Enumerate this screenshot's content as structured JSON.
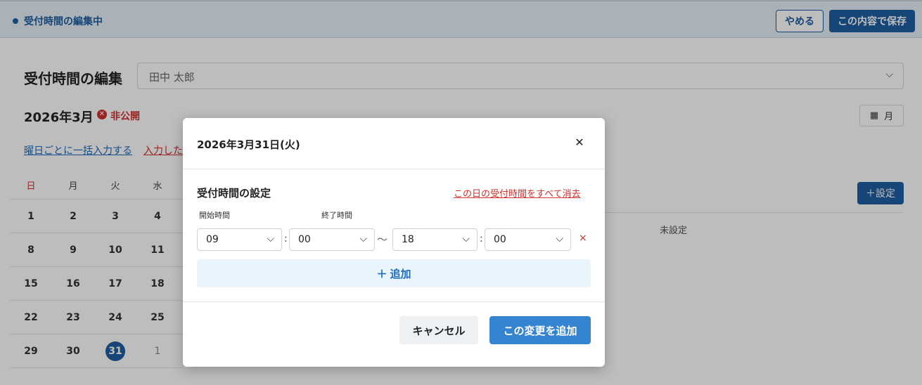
{
  "topbar": {
    "status": "受付時間の編集中",
    "cancel_label": "やめる",
    "save_label": "この内容で保存"
  },
  "page": {
    "title": "受付時間の編集",
    "user_select_value": "田中 太郎",
    "month": "2026年3月",
    "visibility": "非公開",
    "view_mode": "月",
    "link_weekday": "曜日ごとに一括入力する",
    "link_clear": "入力した"
  },
  "calendar": {
    "weekdays": [
      "日",
      "月",
      "火",
      "水"
    ],
    "rows": [
      [
        "1",
        "2",
        "3",
        "4"
      ],
      [
        "8",
        "9",
        "10",
        "11"
      ],
      [
        "15",
        "16",
        "17",
        "18"
      ],
      [
        "22",
        "23",
        "24",
        "25"
      ],
      [
        "29",
        "30",
        "31",
        "1"
      ]
    ],
    "selected": "31"
  },
  "right_panel": {
    "add_setting_label": "＋設定",
    "unset_label": "未設定"
  },
  "modal": {
    "title": "2026年3月31日(火)",
    "section_title": "受付時間の設定",
    "clear_day_label": "この日の受付時間をすべて消去",
    "start_label": "開始時間",
    "end_label": "終了時間",
    "start_hour": "09",
    "start_minute": "00",
    "end_hour": "18",
    "end_minute": "00",
    "tilde": "〜",
    "add_label": "追加",
    "cancel_label": "キャンセル",
    "apply_label": "この変更を追加"
  },
  "colors": {
    "primary": "#1e5fa3",
    "accent": "#3584d2",
    "danger": "#d0312d"
  }
}
